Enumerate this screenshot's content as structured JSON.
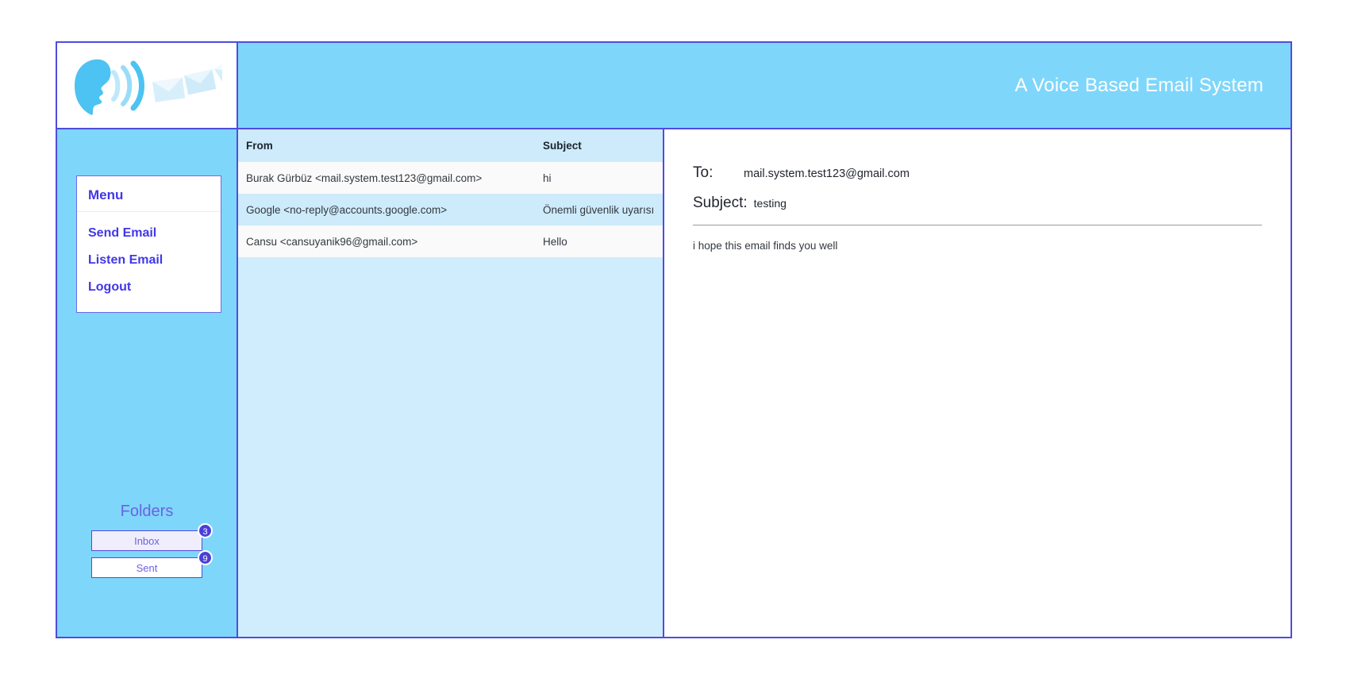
{
  "header": {
    "title": "A Voice Based Email System",
    "logo_alt": "voice-email-logo"
  },
  "sidebar": {
    "menu_heading": "Menu",
    "menu_items": [
      {
        "label": "Send Email"
      },
      {
        "label": "Listen Email"
      },
      {
        "label": "Logout"
      }
    ],
    "folders_title": "Folders",
    "folders": [
      {
        "label": "Inbox",
        "badge": "3",
        "active": true
      },
      {
        "label": "Sent",
        "badge": "9",
        "active": false
      }
    ]
  },
  "email_list": {
    "columns": {
      "from": "From",
      "subject": "Subject"
    },
    "rows": [
      {
        "from": "Burak Gürbüz <mail.system.test123@gmail.com>",
        "subject": "hi"
      },
      {
        "from": "Google <no-reply@accounts.google.com>",
        "subject": "Önemli güvenlik uyarısı"
      },
      {
        "from": "Cansu <cansuyanik96@gmail.com>",
        "subject": "Hello"
      }
    ]
  },
  "reading_pane": {
    "to_label": "To:",
    "to_value": "mail.system.test123@gmail.com",
    "subject_label": "Subject:",
    "subject_value": "testing",
    "body": "i hope this email finds you well"
  },
  "colors": {
    "accent_blue": "#7fd6fb",
    "border_indigo": "#4f4ce0",
    "menu_text": "#4237e8",
    "badge": "#4940d8",
    "list_bg": "#d0edfd",
    "row_alt": "#cdebfb"
  }
}
